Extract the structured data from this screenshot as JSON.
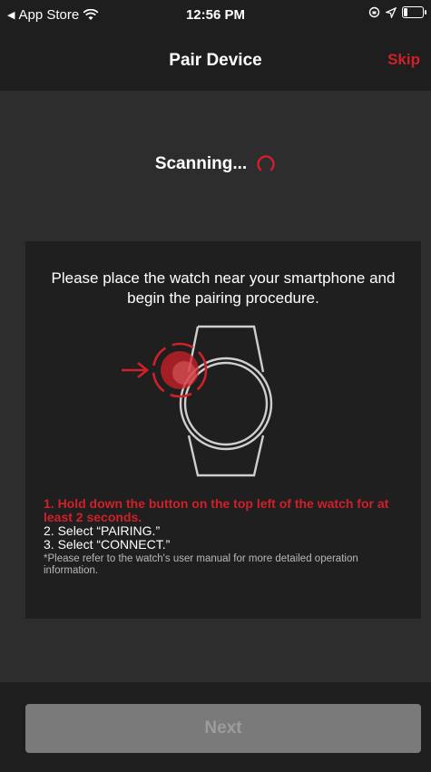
{
  "status_bar": {
    "back_app": "App Store",
    "time": "12:56 PM"
  },
  "nav": {
    "title": "Pair Device",
    "skip_label": "Skip"
  },
  "scanning": {
    "text": "Scanning..."
  },
  "panel": {
    "instruction": "Please place the watch near your smartphone and begin the pairing procedure.",
    "step1": "1. Hold down the button on the top left of the watch for at least 2 seconds.",
    "step2": "2. Select “PAIRING.”",
    "step3": "3. Select “CONNECT.”",
    "note": "*Please refer to the watch's user manual for more detailed operation information."
  },
  "footer": {
    "next_label": "Next"
  },
  "colors": {
    "accent": "#d0202a",
    "background": "#2d2d2d",
    "bar": "#1e1e1e",
    "panel": "#1f1f1f",
    "button_disabled": "#7a7a7a"
  },
  "icons": [
    "back-arrow-icon",
    "wifi-icon",
    "screen-lock-icon",
    "location-icon",
    "battery-icon",
    "spinner-icon",
    "watch-illustration",
    "arrow-icon"
  ]
}
